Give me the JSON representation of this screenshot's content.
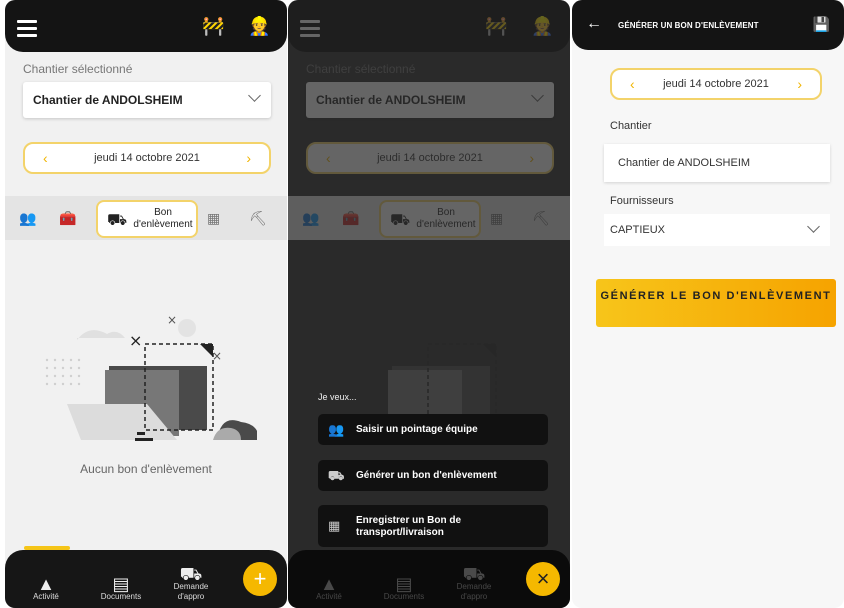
{
  "screen1": {
    "label_chantier_selectionne": "Chantier sélectionné",
    "chantier_value": "Chantier de ANDOLSHEIM",
    "date": "jeudi 14 octobre 2021",
    "active_tab_label": "Bon d'enlèvement",
    "empty_text": "Aucun bon d'enlèvement",
    "bottom_nav": {
      "activite": "Activité",
      "documents": "Documents",
      "demande_appro": "Demande d'appro"
    },
    "fab_label": "+"
  },
  "screen2": {
    "label_chantier_selectionne": "Chantier sélectionné",
    "chantier_value": "Chantier de ANDOLSHEIM",
    "date": "jeudi 14 octobre 2021",
    "active_tab_label": "Bon d'enlèvement",
    "je_veux": "Je veux...",
    "actions": [
      "Saisir un pointage équipe",
      "Générer un bon d'enlèvement",
      "Enregistrer un Bon de transport/livraison"
    ],
    "bottom_nav": {
      "activite": "Activité",
      "documents": "Documents",
      "demande_appro": "Demande d'appro"
    },
    "fab_label": "×"
  },
  "screen3": {
    "title": "GÉNÉRER UN BON D'ENLÈVEMENT",
    "date": "jeudi 14 octobre 2021",
    "label_chantier": "Chantier",
    "chantier_value": "Chantier de ANDOLSHEIM",
    "label_fournisseurs": "Fournisseurs",
    "fournisseur_value": "CAPTIEUX",
    "button": "GÉNÉRER LE BON D'ENLÈVEMENT"
  },
  "colors": {
    "accent": "#f5c518",
    "dark": "#141414"
  },
  "icons": [
    "menu-icon",
    "construction-barrier-icon",
    "worker-icon",
    "team-icon",
    "tools-icon",
    "removal-truck-icon",
    "transport-icon",
    "worker-dig-icon",
    "cone-icon",
    "document-icon",
    "truck-icon",
    "plus-icon",
    "close-icon",
    "back-arrow-icon",
    "save-icon",
    "chevron-down-icon"
  ]
}
